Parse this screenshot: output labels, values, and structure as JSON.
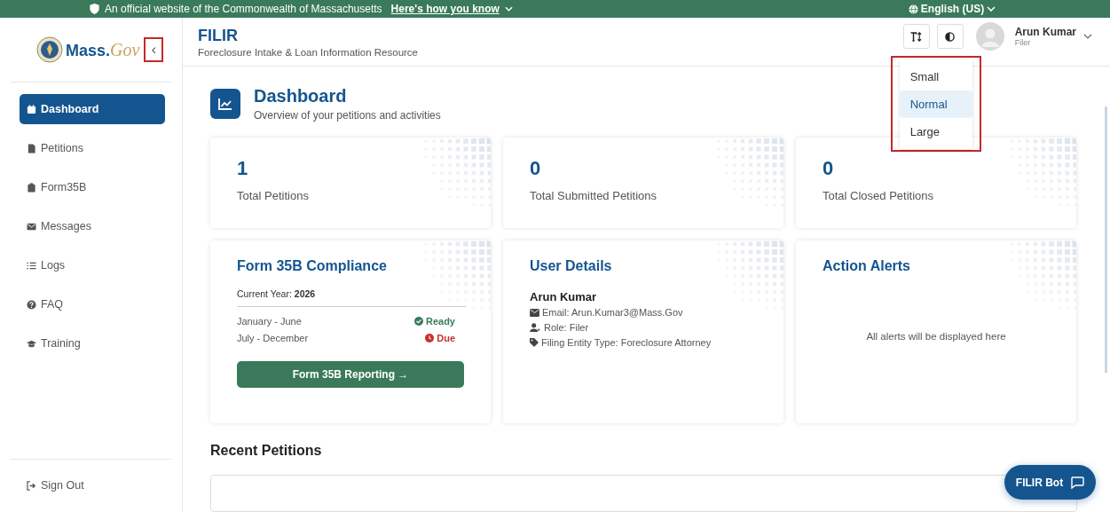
{
  "banner": {
    "text": "An official website of the Commonwealth of Massachusetts",
    "link": "Here's how you know",
    "language": "English (US)"
  },
  "header": {
    "logo_text": "Mass.",
    "logo_script": "Gov",
    "collapse": {
      "glyph": "‹",
      "highlighted": true
    },
    "app_title": "FILIR",
    "app_subtitle": "Foreclosure Intake & Loan Information Resource",
    "user_name": "Arun Kumar",
    "user_role": "Filer"
  },
  "font_size_menu": {
    "highlighted": true,
    "options": [
      {
        "label": "Small",
        "selected": false
      },
      {
        "label": "Normal",
        "selected": true
      },
      {
        "label": "Large",
        "selected": false
      }
    ]
  },
  "sidebar": {
    "items": [
      {
        "label": "Dashboard",
        "kind": "calendar",
        "selected": true
      },
      {
        "label": "Petitions",
        "kind": "file",
        "selected": false
      },
      {
        "label": "Form35B",
        "kind": "clipboard",
        "selected": false
      },
      {
        "label": "Messages",
        "kind": "mail",
        "selected": false
      },
      {
        "label": "Logs",
        "kind": "list",
        "selected": false
      },
      {
        "label": "FAQ",
        "kind": "question",
        "selected": false
      },
      {
        "label": "Training",
        "kind": "cap",
        "selected": false
      }
    ],
    "sign_out": "Sign Out"
  },
  "page": {
    "title": "Dashboard",
    "subtitle": "Overview of your petitions and activities"
  },
  "stats": [
    {
      "value": "1",
      "label": "Total Petitions"
    },
    {
      "value": "0",
      "label": "Total Submitted Petitions"
    },
    {
      "value": "0",
      "label": "Total Closed Petitions"
    }
  ],
  "compliance": {
    "title": "Form 35B Compliance",
    "year_label": "Current Year: ",
    "year": "2026",
    "periods": [
      {
        "period": "January - June",
        "status": "Ready",
        "kind": "ready"
      },
      {
        "period": "July - December",
        "status": "Due",
        "kind": "due"
      }
    ],
    "button": "Form 35B Reporting →"
  },
  "user_details": {
    "title": "User Details",
    "name": "Arun Kumar",
    "lines": [
      {
        "kind": "email",
        "text": "Email: Arun.Kumar3@Mass.Gov"
      },
      {
        "kind": "role",
        "text": "Role: Filer"
      },
      {
        "kind": "tag",
        "text": "Filing Entity Type: Foreclosure Attorney"
      }
    ]
  },
  "alerts": {
    "title": "Action Alerts",
    "empty": "All alerts will be displayed here"
  },
  "recent": {
    "title": "Recent Petitions"
  },
  "chat_button": "FILIR Bot"
}
